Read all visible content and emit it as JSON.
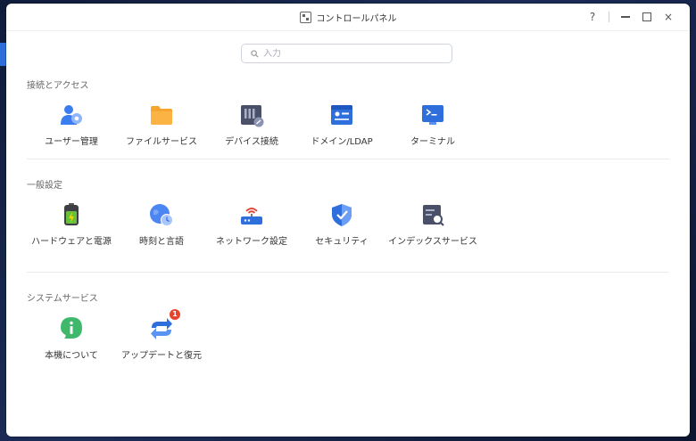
{
  "window": {
    "title": "コントロールパネル"
  },
  "controls": {
    "help": "?",
    "close": "×"
  },
  "search": {
    "placeholder": "入力",
    "value": ""
  },
  "sections": [
    {
      "title": "接続とアクセス",
      "items": [
        {
          "label": "ユーザー管理",
          "icon": "user-management-icon"
        },
        {
          "label": "ファイルサービス",
          "icon": "folder-icon"
        },
        {
          "label": "デバイス接続",
          "icon": "device-connection-icon"
        },
        {
          "label": "ドメイン/LDAP",
          "icon": "domain-ldap-icon"
        },
        {
          "label": "ターミナル",
          "icon": "terminal-icon"
        }
      ]
    },
    {
      "title": "一般設定",
      "items": [
        {
          "label": "ハードウェアと電源",
          "icon": "battery-power-icon"
        },
        {
          "label": "時刻と言語",
          "icon": "globe-clock-icon"
        },
        {
          "label": "ネットワーク設定",
          "icon": "router-icon"
        },
        {
          "label": "セキュリティ",
          "icon": "shield-icon"
        },
        {
          "label": "インデックスサービス",
          "icon": "index-search-icon"
        }
      ]
    },
    {
      "title": "システムサービス",
      "items": [
        {
          "label": "本機について",
          "icon": "info-bubble-icon"
        },
        {
          "label": "アップデートと復元",
          "icon": "update-arrows-icon",
          "badge": "1"
        }
      ]
    }
  ],
  "colors": {
    "accent": "#2f6fdc",
    "badge": "#e8432d"
  }
}
